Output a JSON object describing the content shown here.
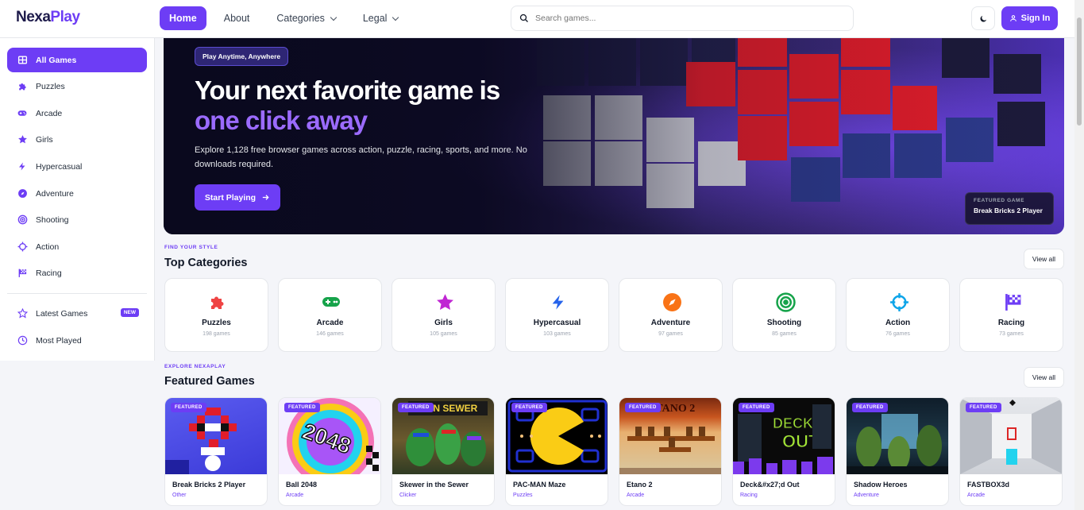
{
  "brand": {
    "part1": "Nexa",
    "part2": "Play"
  },
  "nav": {
    "home": "Home",
    "about": "About",
    "categories": "Categories",
    "legal": "Legal"
  },
  "search": {
    "placeholder": "Search games..."
  },
  "header": {
    "signin": "Sign In"
  },
  "sidebar": {
    "items": [
      {
        "label": "All Games",
        "icon": "grid-icon"
      },
      {
        "label": "Puzzles",
        "icon": "puzzle-icon"
      },
      {
        "label": "Arcade",
        "icon": "gamepad-icon"
      },
      {
        "label": "Girls",
        "icon": "star-icon"
      },
      {
        "label": "Hypercasual",
        "icon": "bolt-icon"
      },
      {
        "label": "Adventure",
        "icon": "compass-icon"
      },
      {
        "label": "Shooting",
        "icon": "target-icon"
      },
      {
        "label": "Action",
        "icon": "crosshair-icon"
      },
      {
        "label": "Racing",
        "icon": "flag-icon"
      }
    ],
    "latest": "Latest Games",
    "new_badge": "NEW",
    "most_played": "Most Played"
  },
  "hero": {
    "pill": "Play Anytime, Anywhere",
    "title1": "Your next favorite game is",
    "title2": "one click away",
    "desc": "Explore 1,128 free browser games across action, puzzle, racing, sports, and more. No downloads required.",
    "cta": "Start Playing",
    "featured_label": "FEATURED GAME",
    "featured_name": "Break Bricks 2 Player"
  },
  "categories_section": {
    "eyebrow": "FIND YOUR STYLE",
    "title": "Top Categories",
    "view_all": "View all",
    "items": [
      {
        "name": "Puzzles",
        "count": "198 games",
        "color": "#ef4444"
      },
      {
        "name": "Arcade",
        "count": "146 games",
        "color": "#16a34a"
      },
      {
        "name": "Girls",
        "count": "105 games",
        "color": "#c026d3"
      },
      {
        "name": "Hypercasual",
        "count": "103 games",
        "color": "#2563eb"
      },
      {
        "name": "Adventure",
        "count": "97 games",
        "color": "#f97316"
      },
      {
        "name": "Shooting",
        "count": "85 games",
        "color": "#16a34a"
      },
      {
        "name": "Action",
        "count": "76 games",
        "color": "#0ea5e9"
      },
      {
        "name": "Racing",
        "count": "73 games",
        "color": "#6d3df5"
      }
    ]
  },
  "featured_section": {
    "eyebrow": "EXPLORE NEXAPLAY",
    "title": "Featured Games",
    "view_all": "View all",
    "tag": "FEATURED",
    "games": [
      {
        "name": "Break Bricks 2 Player",
        "category": "Other"
      },
      {
        "name": "Ball 2048",
        "category": "Arcade"
      },
      {
        "name": "Skewer in the Sewer",
        "category": "Clicker"
      },
      {
        "name": "PAC-MAN Maze",
        "category": "Puzzles"
      },
      {
        "name": "Etano 2",
        "category": "Arcade"
      },
      {
        "name": "Deck&#x27;d Out",
        "category": "Racing"
      },
      {
        "name": "Shadow Heroes",
        "category": "Adventure"
      },
      {
        "name": "FASTBOX3d",
        "category": "Arcade"
      }
    ]
  }
}
